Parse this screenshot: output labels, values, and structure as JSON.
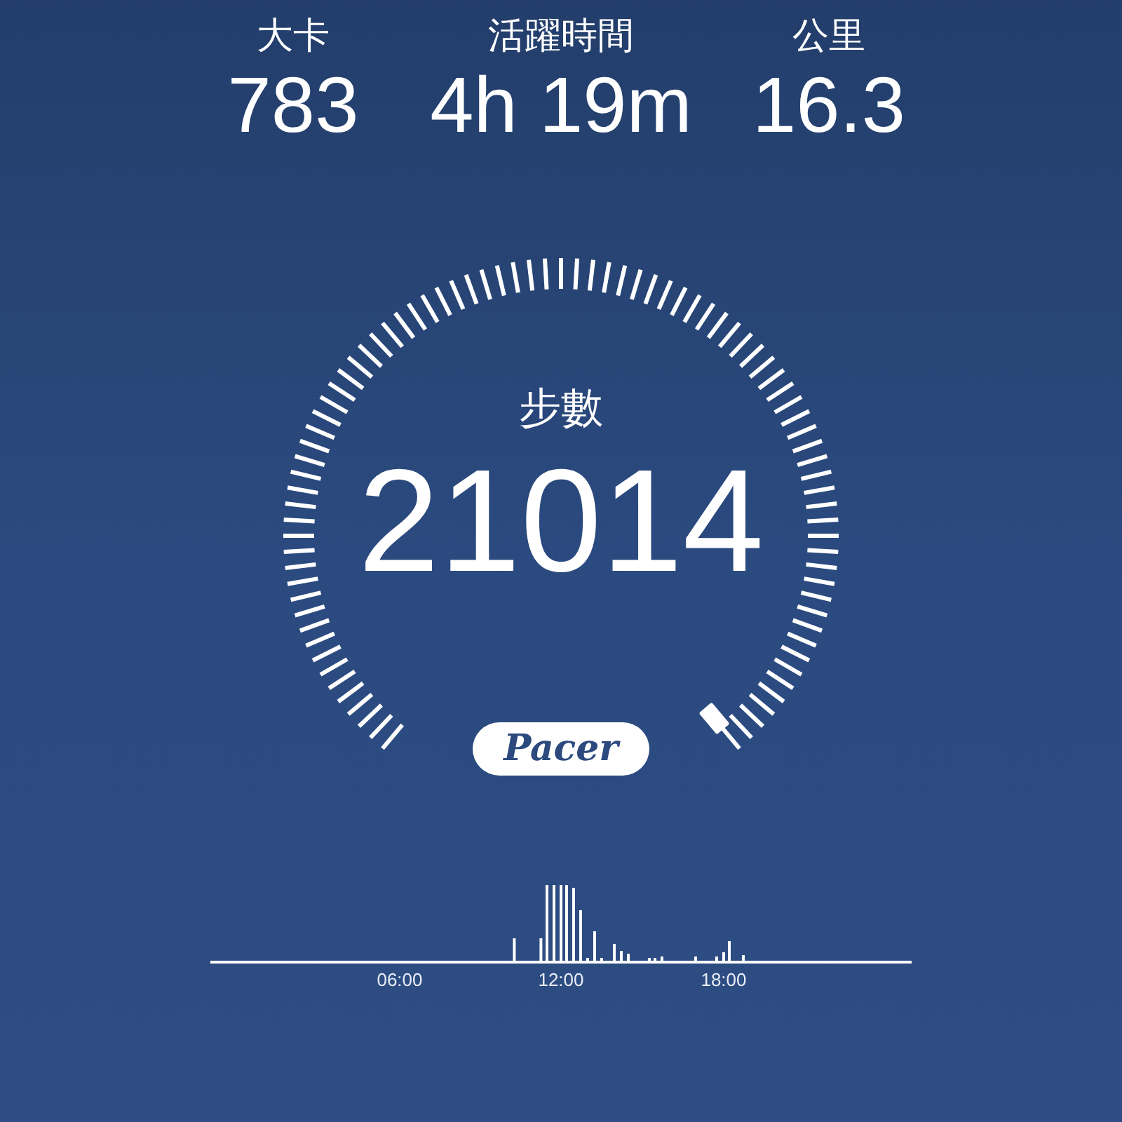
{
  "stats": [
    {
      "label": "大卡",
      "value": "783"
    },
    {
      "label": "活躍時間",
      "value": "4h 19m"
    },
    {
      "label": "公里",
      "value": "16.3"
    }
  ],
  "gauge": {
    "label": "步數",
    "value": "21014"
  },
  "logo": "Pacer",
  "activity_chart": {
    "time_labels": [
      "06:00",
      "12:00",
      "18:00"
    ]
  }
}
